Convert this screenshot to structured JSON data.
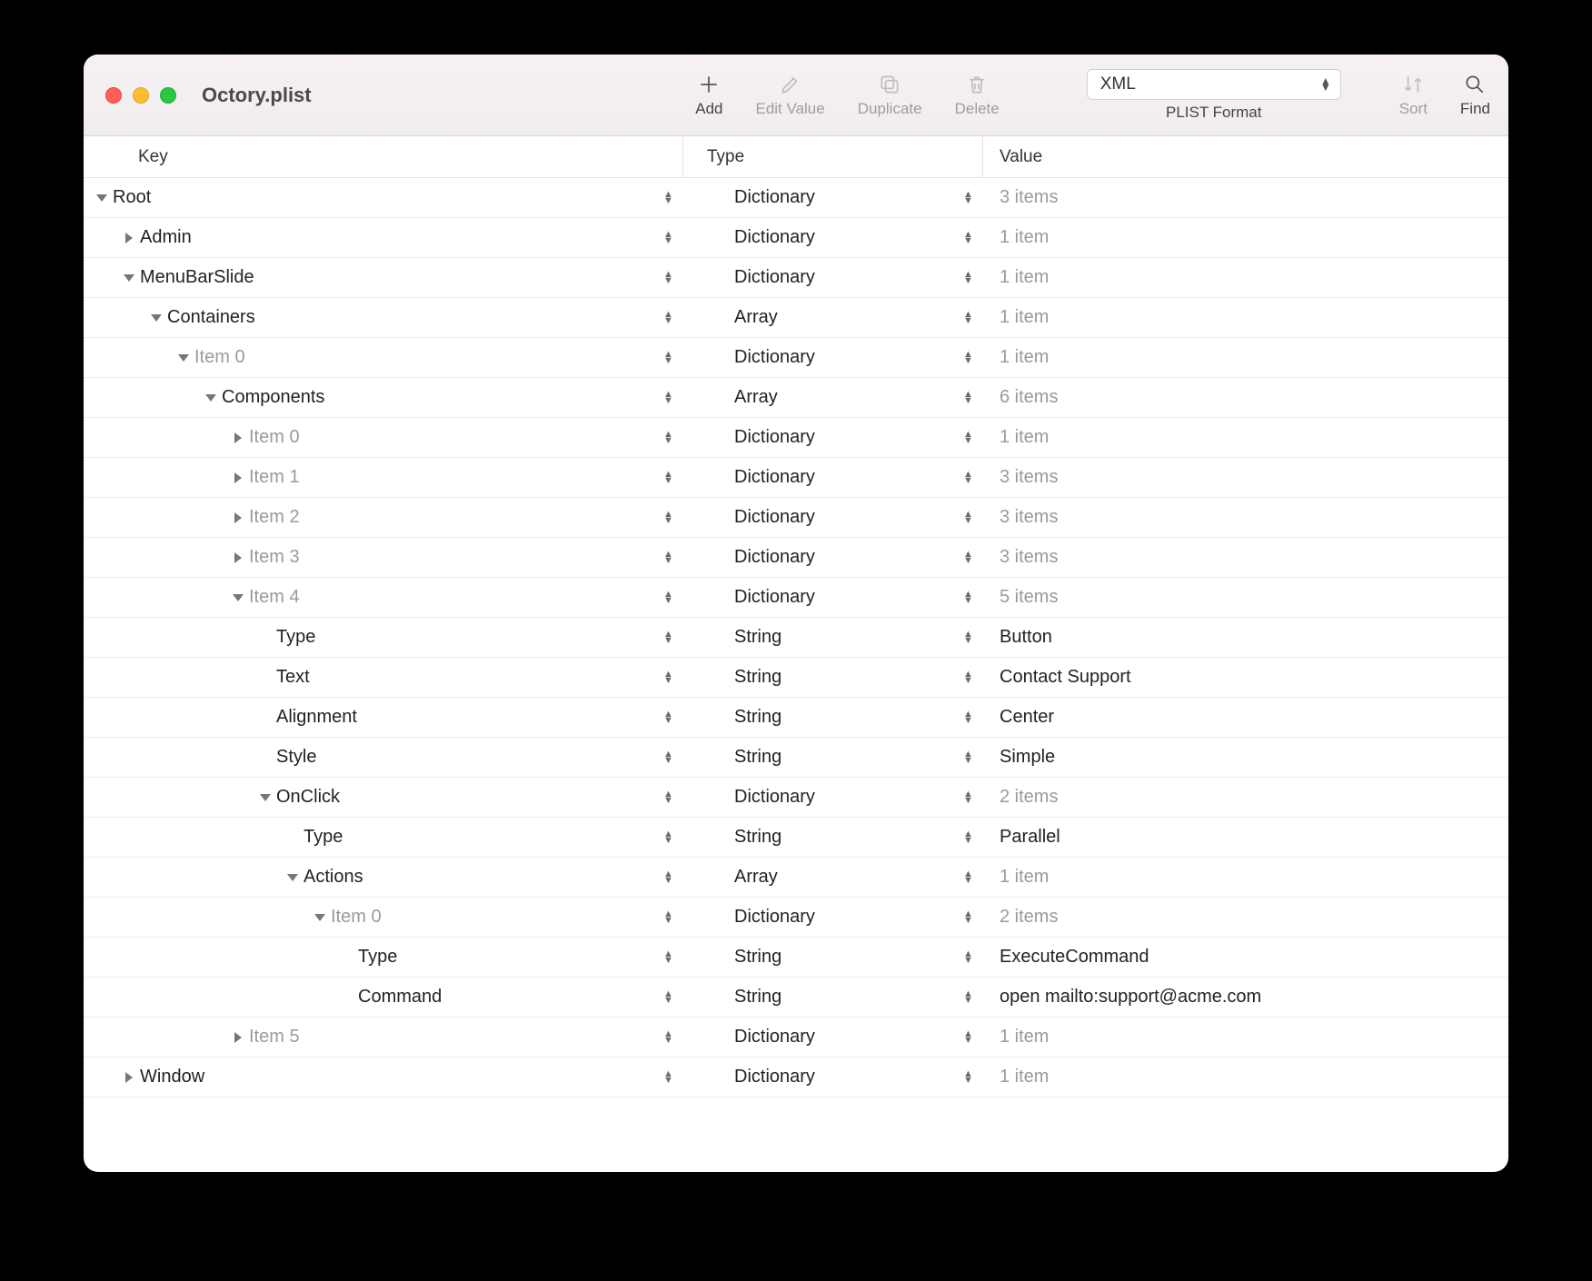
{
  "window": {
    "title": "Octory.plist"
  },
  "toolbar": {
    "add": "Add",
    "edit_value": "Edit Value",
    "duplicate": "Duplicate",
    "delete": "Delete",
    "sort": "Sort",
    "find": "Find",
    "format_selected": "XML",
    "format_label": "PLIST Format"
  },
  "columns": {
    "key": "Key",
    "type": "Type",
    "value": "Value"
  },
  "rows": [
    {
      "indent": 0,
      "disc": "open",
      "key": "Root",
      "dimKey": false,
      "type": "Dictionary",
      "value": "3 items",
      "dimVal": true
    },
    {
      "indent": 1,
      "disc": "closed",
      "key": "Admin",
      "dimKey": false,
      "type": "Dictionary",
      "value": "1 item",
      "dimVal": true
    },
    {
      "indent": 1,
      "disc": "open",
      "key": "MenuBarSlide",
      "dimKey": false,
      "type": "Dictionary",
      "value": "1 item",
      "dimVal": true
    },
    {
      "indent": 2,
      "disc": "open",
      "key": "Containers",
      "dimKey": false,
      "type": "Array",
      "value": "1 item",
      "dimVal": true
    },
    {
      "indent": 3,
      "disc": "open",
      "key": "Item 0",
      "dimKey": true,
      "type": "Dictionary",
      "value": "1 item",
      "dimVal": true
    },
    {
      "indent": 4,
      "disc": "open",
      "key": "Components",
      "dimKey": false,
      "type": "Array",
      "value": "6 items",
      "dimVal": true
    },
    {
      "indent": 5,
      "disc": "closed",
      "key": "Item 0",
      "dimKey": true,
      "type": "Dictionary",
      "value": "1 item",
      "dimVal": true
    },
    {
      "indent": 5,
      "disc": "closed",
      "key": "Item 1",
      "dimKey": true,
      "type": "Dictionary",
      "value": "3 items",
      "dimVal": true
    },
    {
      "indent": 5,
      "disc": "closed",
      "key": "Item 2",
      "dimKey": true,
      "type": "Dictionary",
      "value": "3 items",
      "dimVal": true
    },
    {
      "indent": 5,
      "disc": "closed",
      "key": "Item 3",
      "dimKey": true,
      "type": "Dictionary",
      "value": "3 items",
      "dimVal": true
    },
    {
      "indent": 5,
      "disc": "open",
      "key": "Item 4",
      "dimKey": true,
      "type": "Dictionary",
      "value": "5 items",
      "dimVal": true
    },
    {
      "indent": 6,
      "disc": "none",
      "key": "Type",
      "dimKey": false,
      "type": "String",
      "value": "Button",
      "dimVal": false
    },
    {
      "indent": 6,
      "disc": "none",
      "key": "Text",
      "dimKey": false,
      "type": "String",
      "value": "Contact Support",
      "dimVal": false
    },
    {
      "indent": 6,
      "disc": "none",
      "key": "Alignment",
      "dimKey": false,
      "type": "String",
      "value": "Center",
      "dimVal": false
    },
    {
      "indent": 6,
      "disc": "none",
      "key": "Style",
      "dimKey": false,
      "type": "String",
      "value": "Simple",
      "dimVal": false
    },
    {
      "indent": 6,
      "disc": "open",
      "key": "OnClick",
      "dimKey": false,
      "type": "Dictionary",
      "value": "2 items",
      "dimVal": true
    },
    {
      "indent": 7,
      "disc": "none",
      "key": "Type",
      "dimKey": false,
      "type": "String",
      "value": "Parallel",
      "dimVal": false
    },
    {
      "indent": 7,
      "disc": "open",
      "key": "Actions",
      "dimKey": false,
      "type": "Array",
      "value": "1 item",
      "dimVal": true
    },
    {
      "indent": 8,
      "disc": "open",
      "key": "Item 0",
      "dimKey": true,
      "type": "Dictionary",
      "value": "2 items",
      "dimVal": true
    },
    {
      "indent": 9,
      "disc": "none",
      "key": "Type",
      "dimKey": false,
      "type": "String",
      "value": "ExecuteCommand",
      "dimVal": false
    },
    {
      "indent": 9,
      "disc": "none",
      "key": "Command",
      "dimKey": false,
      "type": "String",
      "value": "open mailto:support@acme.com",
      "dimVal": false
    },
    {
      "indent": 5,
      "disc": "closed",
      "key": "Item 5",
      "dimKey": true,
      "type": "Dictionary",
      "value": "1 item",
      "dimVal": true
    },
    {
      "indent": 1,
      "disc": "closed",
      "key": "Window",
      "dimKey": false,
      "type": "Dictionary",
      "value": "1 item",
      "dimVal": true
    }
  ]
}
